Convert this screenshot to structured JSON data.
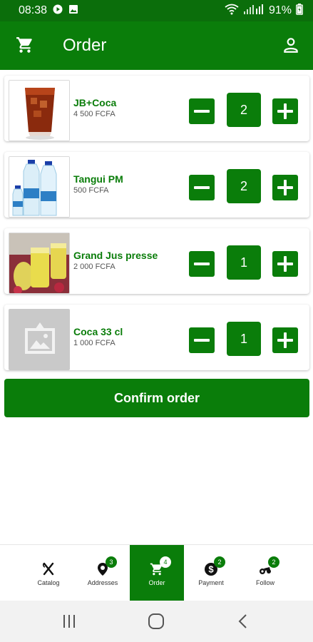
{
  "status_bar": {
    "time": "08:38",
    "battery": "91%"
  },
  "app_bar": {
    "title": "Order"
  },
  "items": [
    {
      "name": "JB+Coca",
      "price": "4 500 FCFA",
      "quantity": "2",
      "image": "cola-glass-image"
    },
    {
      "name": "Tangui PM",
      "price": "500 FCFA",
      "quantity": "2",
      "image": "water-bottles-image"
    },
    {
      "name": "Grand Jus presse",
      "price": "2 000 FCFA",
      "quantity": "1",
      "image": "juice-glasses-image"
    },
    {
      "name": "Coca 33 cl",
      "price": "1 000 FCFA",
      "quantity": "1",
      "image": "image-placeholder-icon"
    }
  ],
  "confirm_label": "Confirm order",
  "bottom_nav": [
    {
      "label": "Catalog",
      "icon": "cutlery-icon",
      "badge": ""
    },
    {
      "label": "Addresses",
      "icon": "map-pin-icon",
      "badge": "3"
    },
    {
      "label": "Order",
      "icon": "cart-icon",
      "badge": "4",
      "active": true
    },
    {
      "label": "Payment",
      "icon": "dollar-icon",
      "badge": "2"
    },
    {
      "label": "Follow",
      "icon": "delivery-icon",
      "badge": "2"
    }
  ],
  "colors": {
    "primary": "#0a7d0a",
    "status_bar": "#0b6e0b",
    "background": "#ffffff"
  }
}
